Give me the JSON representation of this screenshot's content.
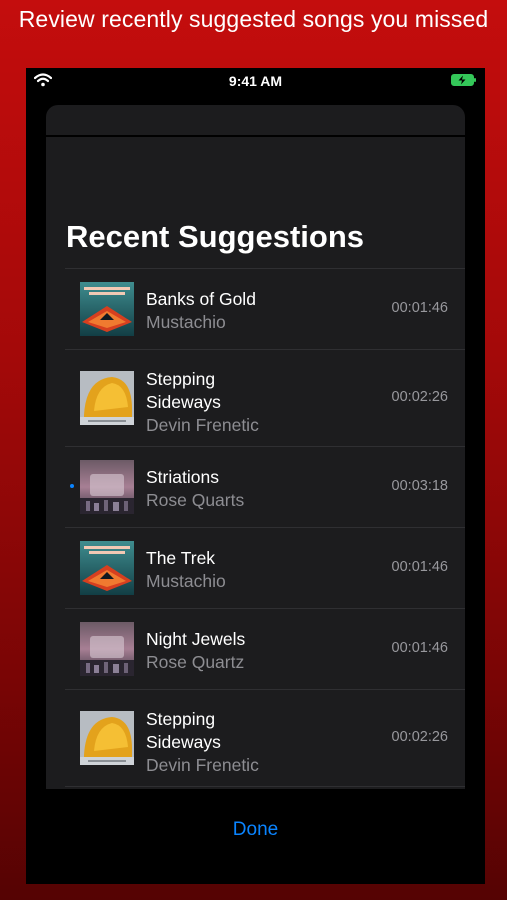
{
  "banner": {
    "text": "Review recently suggested songs you missed"
  },
  "status_bar": {
    "time": "9:41 AM"
  },
  "sheet": {
    "title": "Recent Suggestions"
  },
  "songs": [
    {
      "title": "Banks of Gold",
      "artist": "Mustachio",
      "duration": "00:01:46",
      "art": "kayak-album-art"
    },
    {
      "title": "Stepping Sideways",
      "artist": "Devin Frenetic",
      "duration": "00:02:26",
      "art": "helmet-album-art"
    },
    {
      "title": "Striations",
      "artist": "Rose Quarts",
      "duration": "00:03:18",
      "art": "double-tap-album-art"
    },
    {
      "title": "The Trek",
      "artist": "Mustachio",
      "duration": "00:01:46",
      "art": "kayak-album-art"
    },
    {
      "title": "Night Jewels",
      "artist": "Rose Quartz",
      "duration": "00:01:46",
      "art": "double-tap-album-art"
    },
    {
      "title": "Stepping Sideways",
      "artist": "Devin Frenetic",
      "duration": "00:02:26",
      "art": "helmet-album-art"
    }
  ],
  "done_label": "Done",
  "colors": {
    "accent": "#0a84ff",
    "background_red": "#c40d0d",
    "sheet": "#1c1c1e"
  }
}
